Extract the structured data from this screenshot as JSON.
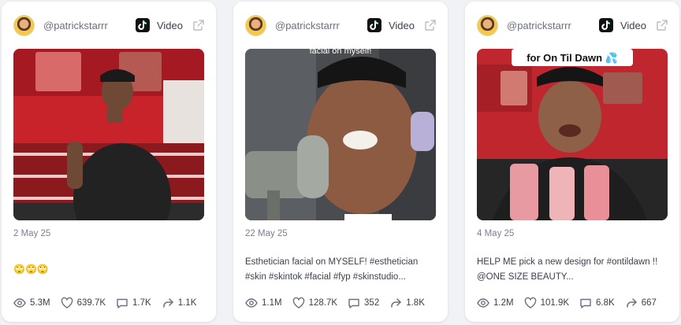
{
  "cards": [
    {
      "username": "@patrickstarrr",
      "platform": {
        "icon": "tiktok-icon",
        "label": "Video"
      },
      "date": "2 May 25",
      "caption": "🙄🙄🙄",
      "stats": {
        "views": "5.3M",
        "likes": "639.7K",
        "comments": "1.7K",
        "shares": "1.1K"
      }
    },
    {
      "username": "@patrickstarrr",
      "platform": {
        "icon": "tiktok-icon",
        "label": "Video"
      },
      "date": "22 May 25",
      "overlay_text": "facial on myself!",
      "caption": "Esthetician facial on MYSELF! #esthetician #skin #skintok #facial #fyp #skinstudio...",
      "stats": {
        "views": "1.1M",
        "likes": "128.7K",
        "comments": "352",
        "shares": "1.8K"
      }
    },
    {
      "username": "@patrickstarrr",
      "platform": {
        "icon": "tiktok-icon",
        "label": "Video"
      },
      "date": "4 May 25",
      "overlay_text": "for On Til Dawn 💦",
      "caption": "HELP ME pick a new design for #ontildawn !! @ONE SIZE BEAUTY...",
      "stats": {
        "views": "1.2M",
        "likes": "101.9K",
        "comments": "6.8K",
        "shares": "667"
      }
    }
  ],
  "colors": {
    "background": "#f1f2f5",
    "card": "#ffffff",
    "text_muted": "#7a8090",
    "text": "#3a3f4c",
    "icon": "#6b7080"
  }
}
